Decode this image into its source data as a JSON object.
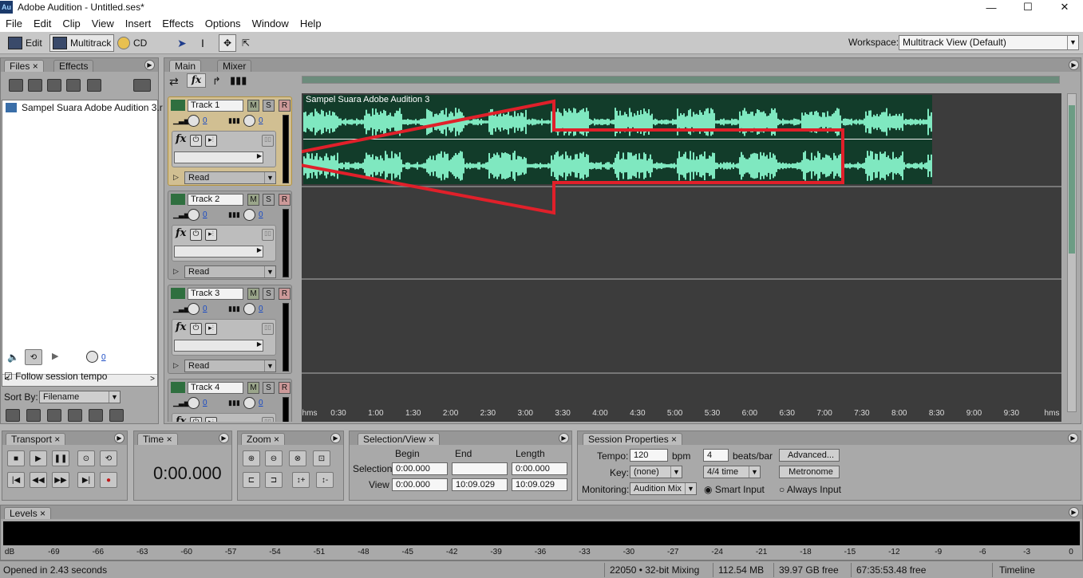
{
  "window": {
    "title": "Adobe Audition - Untitled.ses*",
    "app_icon": "Au"
  },
  "menu": [
    "File",
    "Edit",
    "Clip",
    "View",
    "Insert",
    "Effects",
    "Options",
    "Window",
    "Help"
  ],
  "toolbar": {
    "edit": "Edit",
    "multitrack": "Multitrack",
    "cd": "CD",
    "workspace_label": "Workspace:",
    "workspace_value": "Multitrack View (Default)"
  },
  "files_panel": {
    "tab_files": "Files",
    "tab_effects": "Effects",
    "file_item": "Sampel Suara Adobe Audition 3.r",
    "follow_tempo": "Follow session tempo",
    "sort_by": "Sort By:",
    "sort_value": "Filename",
    "volume_value": "0"
  },
  "main_panel": {
    "tab_main": "Main",
    "tab_mixer": "Mixer",
    "clip_name": "Sampel Suara Adobe Audition 3"
  },
  "tracks": [
    {
      "name": "Track 1",
      "vol": "0",
      "pan": "0",
      "mode": "Read"
    },
    {
      "name": "Track 2",
      "vol": "0",
      "pan": "0",
      "mode": "Read"
    },
    {
      "name": "Track 3",
      "vol": "0",
      "pan": "0",
      "mode": "Read"
    },
    {
      "name": "Track 4",
      "vol": "0",
      "pan": "0",
      "mode": ""
    }
  ],
  "track_buttons": {
    "m": "M",
    "s": "S",
    "r": "R",
    "fx": "fx"
  },
  "ruler": [
    "hms",
    "0:30",
    "1:00",
    "1:30",
    "2:00",
    "2:30",
    "3:00",
    "3:30",
    "4:00",
    "4:30",
    "5:00",
    "5:30",
    "6:00",
    "6:30",
    "7:00",
    "7:30",
    "8:00",
    "8:30",
    "9:00",
    "9:30",
    "hms"
  ],
  "transport": {
    "title": "Transport"
  },
  "time": {
    "title": "Time",
    "display": "0:00.000"
  },
  "zoom": {
    "title": "Zoom"
  },
  "selection_view": {
    "title": "Selection/View",
    "col_begin": "Begin",
    "col_end": "End",
    "col_length": "Length",
    "row_selection": "Selection",
    "row_view": "View",
    "sel_begin": "0:00.000",
    "sel_end": "",
    "sel_length": "0:00.000",
    "view_begin": "0:00.000",
    "view_end": "10:09.029",
    "view_length": "10:09.029"
  },
  "session": {
    "title": "Session Properties",
    "tempo_label": "Tempo:",
    "tempo": "120",
    "bpm": "bpm",
    "beats": "4",
    "beats_label": "beats/bar",
    "advanced": "Advanced...",
    "key_label": "Key:",
    "key": "(none)",
    "time_sig": "4/4 time",
    "metronome": "Metronome",
    "monitoring_label": "Monitoring:",
    "monitoring": "Audition Mix",
    "smart_input": "Smart Input",
    "always_input": "Always Input"
  },
  "levels": {
    "title": "Levels",
    "scale": [
      "dB",
      "-69",
      "-66",
      "-63",
      "-60",
      "-57",
      "-54",
      "-51",
      "-48",
      "-45",
      "-42",
      "-39",
      "-36",
      "-33",
      "-30",
      "-27",
      "-24",
      "-21",
      "-18",
      "-15",
      "-12",
      "-9",
      "-6",
      "-3",
      "0"
    ]
  },
  "status": {
    "left": "Opened in 2.43 seconds",
    "mixing": "22050 • 32-bit Mixing",
    "mem": "112.54 MB",
    "free": "39.97 GB free",
    "time_free": "67:35:53.48 free",
    "mode": "Timeline"
  },
  "colors": {
    "waveform": "#7fe8c0",
    "clip_bg": "#123c2a",
    "annotation": "#e0202a",
    "selected_track": "#d1bf92"
  }
}
